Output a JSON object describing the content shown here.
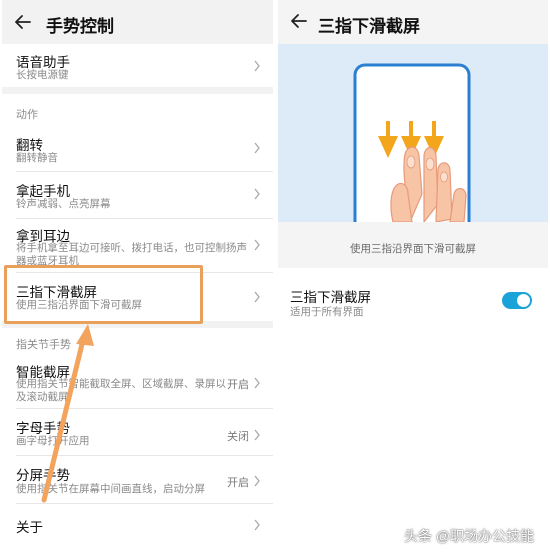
{
  "left": {
    "title": "手势控制",
    "rows_top": [
      {
        "title": "语音助手",
        "sub": "长按电源键"
      }
    ],
    "section_action": "动作",
    "rows_action": [
      {
        "title": "翻转",
        "sub": "翻转静音"
      },
      {
        "title": "拿起手机",
        "sub": "铃声减弱、点亮屏幕"
      },
      {
        "title": "拿到耳边",
        "sub": "将手机拿至耳边可接听、拨打电话，也可控制扬声器或蓝牙耳机"
      },
      {
        "title": "三指下滑截屏",
        "sub": "使用三指沿界面下滑可截屏"
      }
    ],
    "section_knuckle": "指关节手势",
    "rows_knuckle": [
      {
        "title": "智能截屏",
        "sub": "使用指关节智能截取全屏、区域截屏、录屏以及滚动截屏",
        "value": "开启"
      },
      {
        "title": "字母手势",
        "sub": "画字母打开应用",
        "value": "关闭"
      },
      {
        "title": "分屏手势",
        "sub": "使用指关节在屏幕中间画直线，启动分屏",
        "value": "开启"
      },
      {
        "title": "关于",
        "sub": "",
        "value": ""
      }
    ]
  },
  "right": {
    "title": "三指下滑截屏",
    "description": "使用三指沿界面下滑可截屏",
    "setting_title": "三指下滑截屏",
    "setting_sub": "适用于所有界面",
    "toggle_on": true
  },
  "watermark": "头条 @职场办公技能",
  "colors": {
    "accent": "#1aa3d8",
    "highlight": "#e8a05b",
    "illustration_bg": "#dcebf7"
  }
}
